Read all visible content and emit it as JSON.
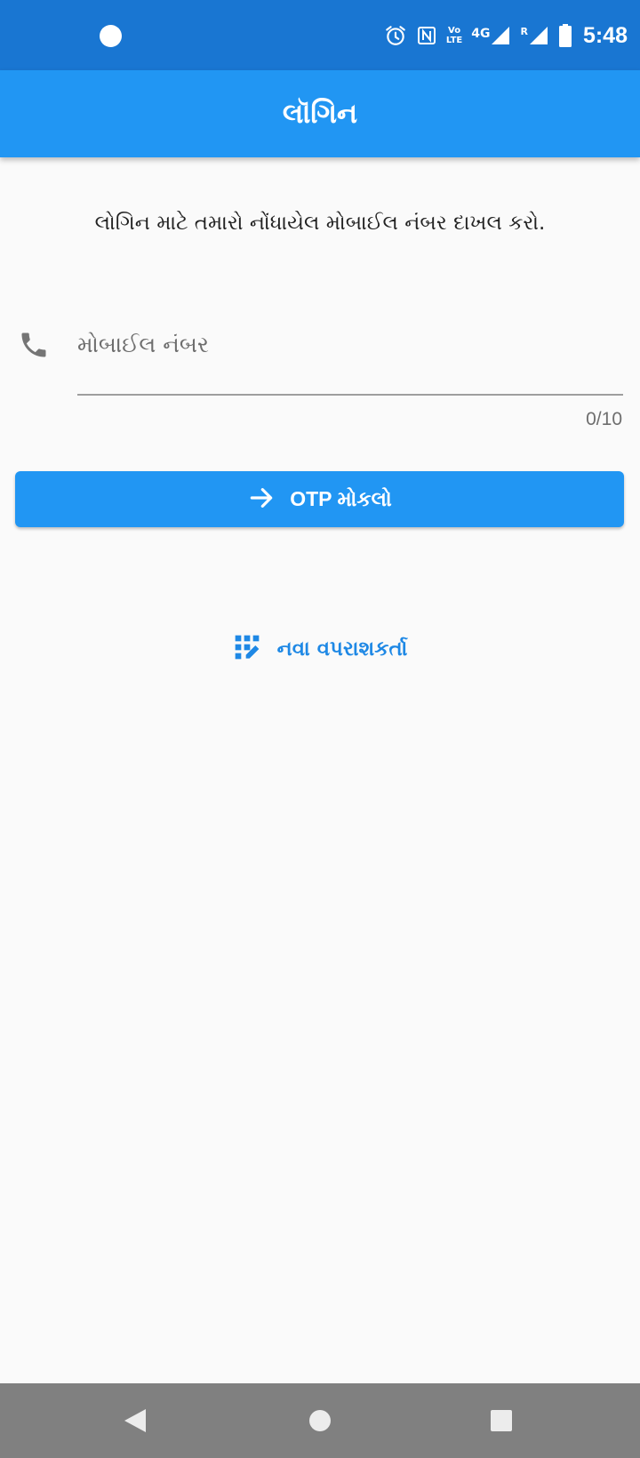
{
  "status_bar": {
    "time": "5:48",
    "volte_line1": "Vo",
    "volte_line2": "LTE",
    "network": "4G",
    "roaming": "R",
    "icons": [
      "notification-dot-icon",
      "alarm-icon",
      "nfc-icon",
      "volte-icon",
      "signal-icon",
      "roaming-signal-icon",
      "battery-icon"
    ]
  },
  "app_bar": {
    "title": "લૉગિન"
  },
  "main": {
    "instruction": "લોગિન માટે તમારો નોંધાયેલ મોબાઈલ નંબર દાખલ કરો.",
    "mobile_input": {
      "placeholder": "મોબાઈલ નંબર",
      "value": "",
      "counter": "0/10",
      "icon": "phone-icon"
    },
    "otp_button": {
      "label": "OTP મોકલો",
      "icon": "arrow-right-icon"
    },
    "new_user_link": {
      "label": "નવા વપરાશકર્તા",
      "icon": "app-registration-icon"
    }
  },
  "nav_bar": {
    "buttons": [
      "back-icon",
      "home-icon",
      "recents-icon"
    ]
  },
  "colors": {
    "status_bar": "#1976d2",
    "primary": "#2196f3",
    "link": "#1e88e5",
    "background": "#fafafa",
    "nav_bar": "#808080"
  }
}
